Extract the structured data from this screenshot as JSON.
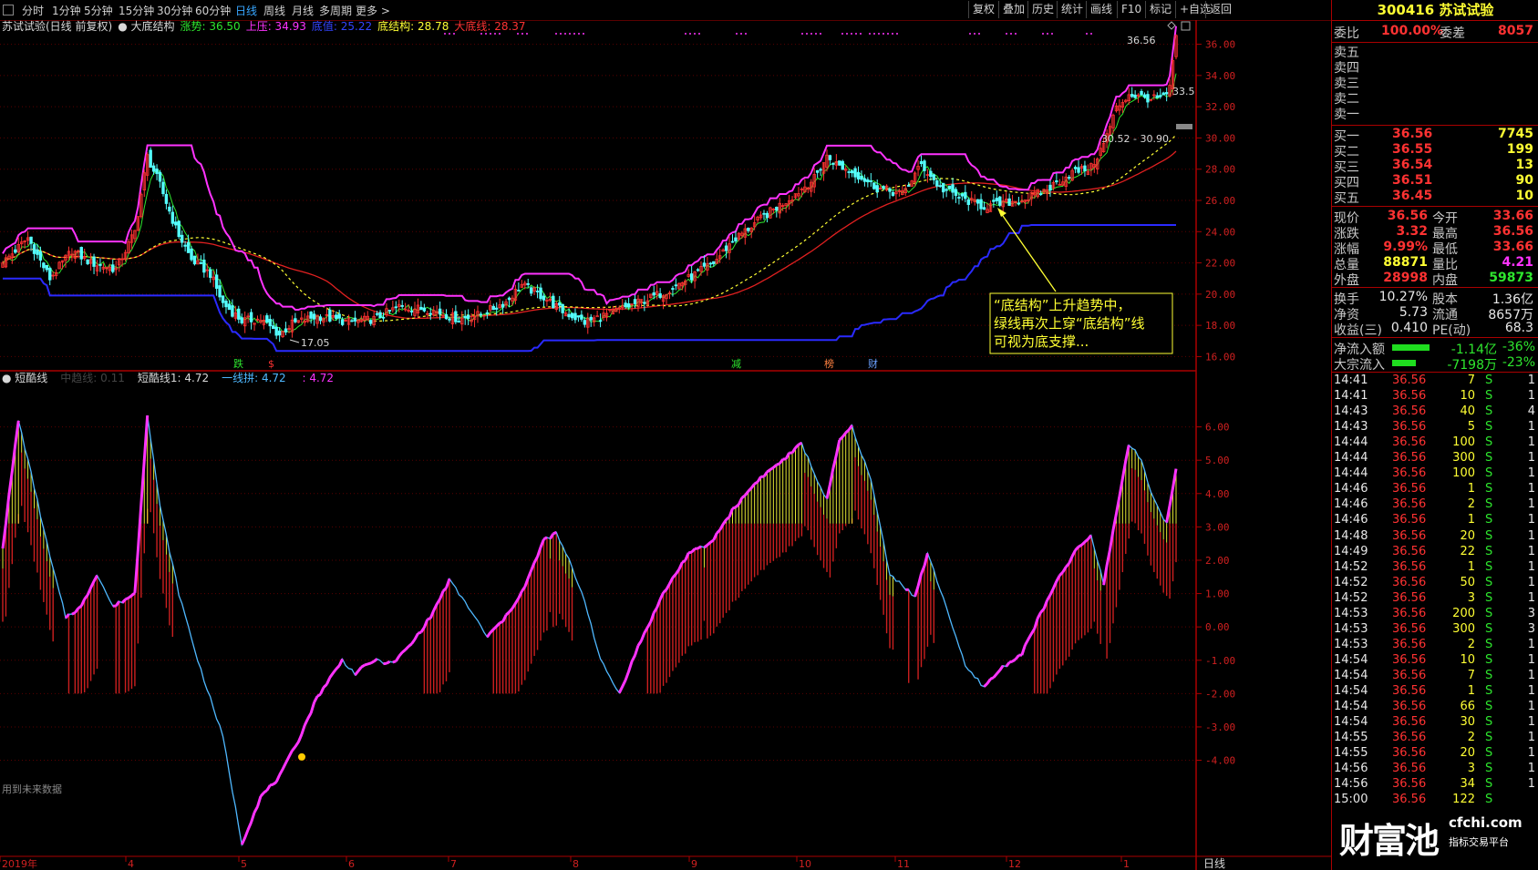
{
  "toolbar": {
    "periods": [
      "分时",
      "1分钟",
      "5分钟",
      "15分钟",
      "30分钟",
      "60分钟",
      "日线",
      "周线",
      "月线",
      "多周期",
      "更多 >"
    ],
    "active": "日线",
    "right_buttons": [
      "复权",
      "叠加",
      "历史",
      "统计",
      "画线",
      "F10",
      "标记",
      "+自选",
      "返回"
    ]
  },
  "header": {
    "name": "苏试试验(日线 前复权)",
    "indicator": "大底结构",
    "values": [
      {
        "text": "涨势: 36.50",
        "color": "#2ee62e"
      },
      {
        "text": "上压: 34.93",
        "color": "#ff33ff"
      },
      {
        "text": "底值: 25.22",
        "color": "#3344ff"
      },
      {
        "text": "底结构: 28.78",
        "color": "#ffff33"
      },
      {
        "text": "大底线: 28.37",
        "color": "#ff3333"
      }
    ]
  },
  "sub_header": {
    "name": "短酷线",
    "values": [
      {
        "text": "中趋线: 0.11",
        "color": "#444444"
      },
      {
        "text": "短酷线1: 4.72",
        "color": "#d8d8d8"
      },
      {
        "text": "一线拼: 4.72",
        "color": "#4fb8ff"
      },
      {
        "text": " : 4.72",
        "color": "#ff33ff"
      }
    ]
  },
  "annotation": {
    "lines": [
      "“底结构”上升趋势中，",
      "绿线再次上穿“底结构”线",
      "可视为底支撑..."
    ]
  },
  "price_labels": {
    "high": "36.56",
    "low": "17.05",
    "range": "30.52 - 30.90",
    "side": "33.5"
  },
  "signals": [
    "跌",
    "$",
    "减",
    "榜",
    "财"
  ],
  "footer_note": "用到未来数据",
  "x_axis_labels": [
    "2019年",
    "4",
    "5",
    "6",
    "7",
    "8",
    "9",
    "10",
    "11",
    "12",
    "1"
  ],
  "period_label": "日线",
  "colors": {
    "up": "#ff3232",
    "down": "#54ffff",
    "grid": "#5a0000",
    "ma_yellow": "#ffff33",
    "ma_red": "#e02020",
    "blue": "#2a2aff",
    "magenta": "#ff33ff",
    "green": "#2ee62e"
  },
  "quote": {
    "code": "300416",
    "name": "苏试试验",
    "weibi_label": "委比",
    "weibi": "100.00%",
    "weicha_label": "委差",
    "weicha": "8057",
    "sells": [
      {
        "label": "卖五"
      },
      {
        "label": "卖四"
      },
      {
        "label": "卖三"
      },
      {
        "label": "卖二"
      },
      {
        "label": "卖一"
      }
    ],
    "buys": [
      {
        "label": "买一",
        "price": "36.56",
        "vol": "7745"
      },
      {
        "label": "买二",
        "price": "36.55",
        "vol": "199"
      },
      {
        "label": "买三",
        "price": "36.54",
        "vol": "13"
      },
      {
        "label": "买四",
        "price": "36.51",
        "vol": "90"
      },
      {
        "label": "买五",
        "price": "36.45",
        "vol": "10"
      }
    ],
    "stats": [
      {
        "l1": "现价",
        "v1": "36.56",
        "c1": "#ff3232",
        "l2": "今开",
        "v2": "33.66",
        "c2": "#ff3232"
      },
      {
        "l1": "涨跌",
        "v1": "3.32",
        "c1": "#ff3232",
        "l2": "最高",
        "v2": "36.56",
        "c2": "#ff3232"
      },
      {
        "l1": "涨幅",
        "v1": "9.99%",
        "c1": "#ff3232",
        "l2": "最低",
        "v2": "33.66",
        "c2": "#ff3232"
      },
      {
        "l1": "总量",
        "v1": "88871",
        "c1": "#ffff33",
        "l2": "量比",
        "v2": "4.21",
        "c2": "#ff33ff"
      },
      {
        "l1": "外盘",
        "v1": "28998",
        "c1": "#ff3232",
        "l2": "内盘",
        "v2": "59873",
        "c2": "#2ee62e"
      }
    ],
    "stats2": [
      {
        "l1": "换手",
        "v1": "10.27%",
        "l2": "股本",
        "v2": "1.36亿"
      },
      {
        "l1": "净资",
        "v1": "5.73",
        "l2": "流通",
        "v2": "8657万"
      },
      {
        "l1": "收益(三)",
        "v1": "0.410",
        "l2": "PE(动)",
        "v2": "68.3"
      }
    ],
    "flows": [
      {
        "label": "净流入额",
        "value": "-1.14亿",
        "pct": "-36%",
        "bar": 0.36
      },
      {
        "label": "大宗流入",
        "value": "-7198万",
        "pct": "-23%",
        "bar": 0.23
      }
    ]
  },
  "ticks": [
    [
      "14:41",
      "36.56",
      "7",
      "S",
      "1"
    ],
    [
      "14:41",
      "36.56",
      "10",
      "S",
      "1"
    ],
    [
      "14:43",
      "36.56",
      "40",
      "S",
      "4"
    ],
    [
      "14:43",
      "36.56",
      "5",
      "S",
      "1"
    ],
    [
      "14:44",
      "36.56",
      "100",
      "S",
      "1"
    ],
    [
      "14:44",
      "36.56",
      "300",
      "S",
      "1"
    ],
    [
      "14:44",
      "36.56",
      "100",
      "S",
      "1"
    ],
    [
      "14:46",
      "36.56",
      "1",
      "S",
      "1"
    ],
    [
      "14:46",
      "36.56",
      "2",
      "S",
      "1"
    ],
    [
      "14:46",
      "36.56",
      "1",
      "S",
      "1"
    ],
    [
      "14:48",
      "36.56",
      "20",
      "S",
      "1"
    ],
    [
      "14:49",
      "36.56",
      "22",
      "S",
      "1"
    ],
    [
      "14:52",
      "36.56",
      "1",
      "S",
      "1"
    ],
    [
      "14:52",
      "36.56",
      "50",
      "S",
      "1"
    ],
    [
      "14:52",
      "36.56",
      "3",
      "S",
      "1"
    ],
    [
      "14:53",
      "36.56",
      "200",
      "S",
      "3"
    ],
    [
      "14:53",
      "36.56",
      "300",
      "S",
      "3"
    ],
    [
      "14:53",
      "36.56",
      "2",
      "S",
      "1"
    ],
    [
      "14:54",
      "36.56",
      "10",
      "S",
      "1"
    ],
    [
      "14:54",
      "36.56",
      "7",
      "S",
      "1"
    ],
    [
      "14:54",
      "36.56",
      "1",
      "S",
      "1"
    ],
    [
      "14:54",
      "36.56",
      "66",
      "S",
      "1"
    ],
    [
      "14:54",
      "36.56",
      "30",
      "S",
      "1"
    ],
    [
      "14:55",
      "36.56",
      "2",
      "S",
      "1"
    ],
    [
      "14:55",
      "36.56",
      "20",
      "S",
      "1"
    ],
    [
      "14:56",
      "36.56",
      "3",
      "S",
      "1"
    ],
    [
      "14:56",
      "36.56",
      "34",
      "S",
      "1"
    ],
    [
      "15:00",
      "36.56",
      "122",
      "S",
      ""
    ]
  ],
  "watermark": {
    "text": "财富池",
    "site": "cfchi.com",
    "slogan": "指标交易平台"
  },
  "chart_data": [
    {
      "type": "candlestick",
      "title": "大底结构",
      "ylim": [
        15.5,
        37.2
      ],
      "yticks": [
        16,
        18,
        20,
        22,
        24,
        26,
        28,
        30,
        32,
        34,
        36
      ],
      "anchors": [
        [
          0,
          22.0
        ],
        [
          8,
          23.6
        ],
        [
          15,
          21.0
        ],
        [
          22,
          22.8
        ],
        [
          28,
          22.0
        ],
        [
          36,
          21.6
        ],
        [
          42,
          24.0
        ],
        [
          46,
          28.8
        ],
        [
          50,
          27.0
        ],
        [
          55,
          24.2
        ],
        [
          60,
          22.2
        ],
        [
          66,
          21.3
        ],
        [
          70,
          19.4
        ],
        [
          76,
          18.3
        ],
        [
          82,
          18.4
        ],
        [
          88,
          17.4
        ],
        [
          92,
          18.1
        ],
        [
          100,
          18.6
        ],
        [
          110,
          18.2
        ],
        [
          118,
          18.4
        ],
        [
          126,
          19.2
        ],
        [
          136,
          19.0
        ],
        [
          145,
          18.4
        ],
        [
          152,
          18.7
        ],
        [
          160,
          19.5
        ],
        [
          165,
          20.6
        ],
        [
          172,
          19.8
        ],
        [
          178,
          18.9
        ],
        [
          185,
          18.2
        ],
        [
          192,
          18.7
        ],
        [
          200,
          19.3
        ],
        [
          210,
          20.1
        ],
        [
          218,
          21.0
        ],
        [
          226,
          22.0
        ],
        [
          232,
          23.4
        ],
        [
          242,
          25.0
        ],
        [
          250,
          26.1
        ],
        [
          258,
          27.4
        ],
        [
          262,
          28.8
        ],
        [
          266,
          28.2
        ],
        [
          272,
          27.6
        ],
        [
          278,
          26.8
        ],
        [
          286,
          26.4
        ],
        [
          292,
          28.3
        ],
        [
          298,
          26.8
        ],
        [
          305,
          26.1
        ],
        [
          312,
          25.6
        ],
        [
          318,
          25.8
        ],
        [
          325,
          26.1
        ],
        [
          332,
          26.7
        ],
        [
          340,
          27.8
        ],
        [
          346,
          28.1
        ],
        [
          350,
          29.6
        ],
        [
          354,
          31.9
        ],
        [
          358,
          32.8
        ],
        [
          362,
          32.6
        ],
        [
          366,
          32.5
        ],
        [
          370,
          32.6
        ],
        [
          371,
          33.3
        ],
        [
          373,
          36.56
        ]
      ]
    },
    {
      "type": "bar",
      "title": "短酷线",
      "ylim": [
        -6.8,
        7.0
      ],
      "yticks": [
        6,
        5,
        4,
        3,
        2,
        1,
        0,
        -1,
        -2,
        -3,
        -4
      ],
      "anchors": [
        [
          0,
          2.4
        ],
        [
          5,
          6.2
        ],
        [
          10,
          4.2
        ],
        [
          15,
          2.1
        ],
        [
          20,
          0.3
        ],
        [
          25,
          0.6
        ],
        [
          30,
          1.6
        ],
        [
          35,
          0.6
        ],
        [
          42,
          1.0
        ],
        [
          46,
          6.4
        ],
        [
          50,
          3.6
        ],
        [
          56,
          1.0
        ],
        [
          62,
          -1.0
        ],
        [
          70,
          -3.3
        ],
        [
          76,
          -6.5
        ],
        [
          82,
          -5.1
        ],
        [
          88,
          -4.5
        ],
        [
          94,
          -3.4
        ],
        [
          100,
          -2.1
        ],
        [
          108,
          -1.0
        ],
        [
          112,
          -1.4
        ],
        [
          118,
          -1.0
        ],
        [
          124,
          -1.1
        ],
        [
          130,
          -0.5
        ],
        [
          136,
          0.3
        ],
        [
          142,
          1.4
        ],
        [
          148,
          0.6
        ],
        [
          154,
          -0.3
        ],
        [
          160,
          0.3
        ],
        [
          166,
          1.2
        ],
        [
          172,
          2.6
        ],
        [
          176,
          2.8
        ],
        [
          180,
          2.0
        ],
        [
          185,
          0.8
        ],
        [
          190,
          -1.0
        ],
        [
          196,
          -2.0
        ],
        [
          202,
          -0.6
        ],
        [
          210,
          1.0
        ],
        [
          218,
          2.2
        ],
        [
          225,
          2.5
        ],
        [
          232,
          3.5
        ],
        [
          240,
          4.4
        ],
        [
          248,
          5.0
        ],
        [
          254,
          5.5
        ],
        [
          258,
          4.6
        ],
        [
          262,
          3.8
        ],
        [
          266,
          5.6
        ],
        [
          270,
          6.0
        ],
        [
          276,
          4.4
        ],
        [
          282,
          1.6
        ],
        [
          290,
          0.9
        ],
        [
          294,
          2.2
        ],
        [
          300,
          0.6
        ],
        [
          306,
          -1.2
        ],
        [
          312,
          -1.8
        ],
        [
          318,
          -1.2
        ],
        [
          324,
          -0.8
        ],
        [
          330,
          0.4
        ],
        [
          336,
          1.5
        ],
        [
          342,
          2.4
        ],
        [
          346,
          2.7
        ],
        [
          350,
          1.3
        ],
        [
          354,
          3.4
        ],
        [
          358,
          5.5
        ],
        [
          362,
          5.0
        ],
        [
          366,
          3.8
        ],
        [
          370,
          3.1
        ],
        [
          373,
          4.72
        ]
      ]
    }
  ]
}
